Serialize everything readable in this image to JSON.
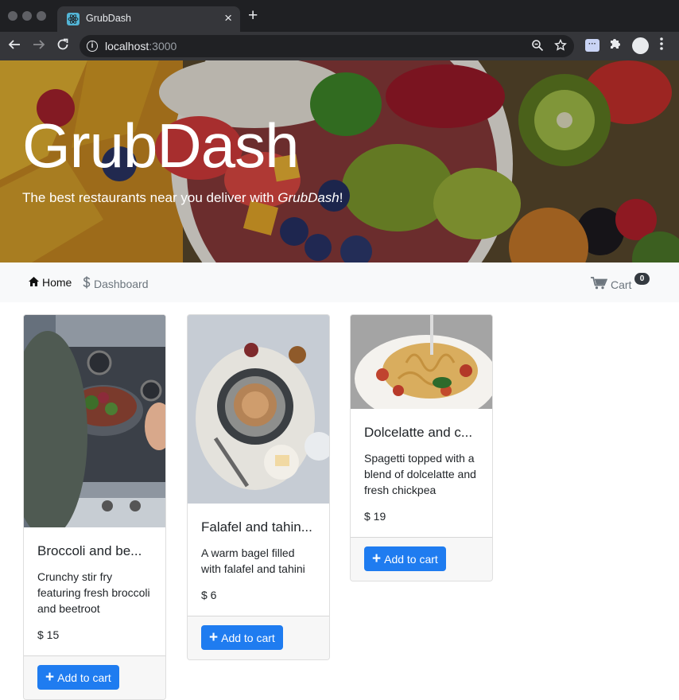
{
  "browser": {
    "tab_title": "GrubDash",
    "tab_close": "×",
    "new_tab": "+",
    "url_host": "localhost",
    "url_port": ":3000",
    "extension_label": "···"
  },
  "hero": {
    "title": "GrubDash",
    "tagline_prefix": "The best restaurants near you deliver with ",
    "tagline_brand": "GrubDash",
    "tagline_suffix": "!"
  },
  "nav": {
    "home": "Home",
    "dashboard": "Dashboard",
    "cart": "Cart",
    "cart_count": "0"
  },
  "dishes": [
    {
      "name": "Broccoli and be...",
      "description": "Crunchy stir fry featuring fresh broccoli and beetroot",
      "price": "$ 15",
      "button": "Add to cart"
    },
    {
      "name": "Falafel and tahin...",
      "description": "A warm bagel filled with falafel and tahini",
      "price": "$ 6",
      "button": "Add to cart"
    },
    {
      "name": "Dolcelatte and c...",
      "description": "Spagetti topped with a blend of dolcelatte and fresh chickpea",
      "price": "$ 19",
      "button": "Add to cart"
    }
  ],
  "colors": {
    "primary_button": "#1f7cf0",
    "navbar_bg": "#f8f9fa",
    "badge_bg": "#343a40"
  }
}
